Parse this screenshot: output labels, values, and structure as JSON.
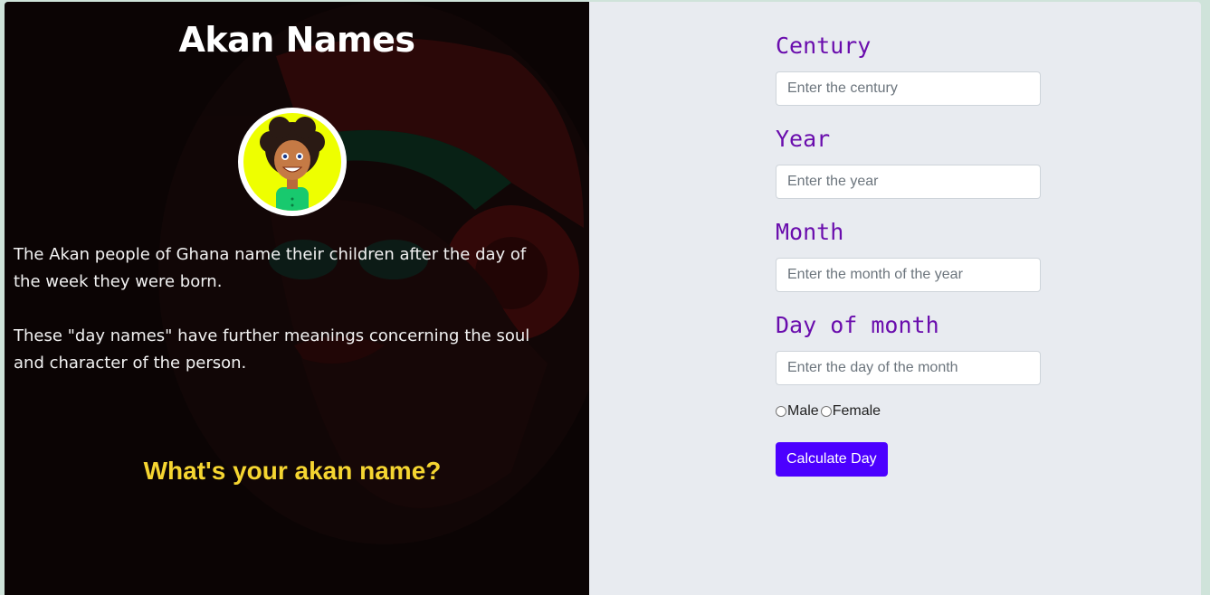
{
  "left_panel": {
    "title": "Akan Names",
    "intro_paragraphs": [
      "The Akan people of Ghana name their children after the day of the week they were born.",
      "These \"day names\" have further meanings concerning the soul and character of the person."
    ],
    "question": "What's your akan name?",
    "avatar_icon": "person-avatar-icon",
    "background_image": "woman-portrait-illustration"
  },
  "form": {
    "century": {
      "label": "Century",
      "placeholder": "Enter the century",
      "value": ""
    },
    "year": {
      "label": "Year",
      "placeholder": "Enter the year",
      "value": ""
    },
    "month": {
      "label": "Month",
      "placeholder": "Enter the month of the year",
      "value": ""
    },
    "day": {
      "label": "Day of month",
      "placeholder": "Enter the day of the month",
      "value": ""
    },
    "gender": {
      "options": [
        {
          "label": "Male",
          "checked": false
        },
        {
          "label": "Female",
          "checked": false
        }
      ]
    },
    "submit_label": "Calculate Day"
  },
  "colors": {
    "label_purple": "#6a0dad",
    "button_blue": "#4c00ff",
    "question_yellow": "#f5d531",
    "avatar_yellow": "#eeff00",
    "right_bg": "#e8ebf0"
  }
}
